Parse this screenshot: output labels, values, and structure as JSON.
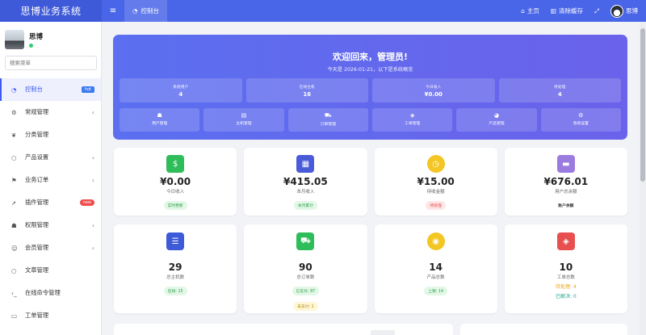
{
  "header": {
    "brand": "思博业务系统",
    "menu_icon": "≡",
    "tab_label": "控制台",
    "home": "主页",
    "clear_cache": "清除缓存",
    "username": "思博"
  },
  "sidebar": {
    "user_name": "思博",
    "search_placeholder": "搜索菜单",
    "items": [
      {
        "label": "控制台",
        "badge": "hot"
      },
      {
        "label": "常规管理"
      },
      {
        "label": "分类管理"
      },
      {
        "label": "产品设置"
      },
      {
        "label": "业务订单"
      },
      {
        "label": "插件管理",
        "badge": "new"
      },
      {
        "label": "权限管理"
      },
      {
        "label": "会员管理"
      },
      {
        "label": "文章管理"
      },
      {
        "label": "在线命令管理"
      },
      {
        "label": "工单管理"
      }
    ]
  },
  "welcome": {
    "title": "欢迎回来，管理员!",
    "subtitle": "今天是 2026-01-21，以下是系统概览",
    "stats": [
      {
        "label": "系统用户",
        "value": "4"
      },
      {
        "label": "在线主机",
        "value": "16"
      },
      {
        "label": "今日收入",
        "value": "¥0.00"
      },
      {
        "label": "待处理",
        "value": "4"
      }
    ],
    "quick": [
      {
        "label": "用户管理"
      },
      {
        "label": "主机管理"
      },
      {
        "label": "订单管理"
      },
      {
        "label": "工单管理"
      },
      {
        "label": "产品管理"
      },
      {
        "label": "系统设置"
      }
    ]
  },
  "cards_row1": [
    {
      "value": "¥0.00",
      "label": "今日收入",
      "tag": "实时更新",
      "color": "#2fbd5a"
    },
    {
      "value": "¥415.05",
      "label": "本月收入",
      "tag": "本月累计",
      "color": "#4a5bd8"
    },
    {
      "value": "¥15.00",
      "label": "待收金额",
      "tag": "待处理",
      "color": "#f3c623"
    },
    {
      "value": "¥676.01",
      "label": "用户总余额",
      "tag": "账户余额",
      "color": "#9b7be0"
    }
  ],
  "cards_row2": [
    {
      "value": "29",
      "label": "总主机数",
      "tag": "在线: 15",
      "color": "#3d5bd8"
    },
    {
      "value": "90",
      "label": "总订单数",
      "tag": "已支付: 87",
      "tag2": "未支付: 1",
      "color": "#2fbd5a"
    },
    {
      "value": "14",
      "label": "产品总数",
      "tag": "上架: 14",
      "color": "#f3c623"
    },
    {
      "value": "10",
      "label": "工单总数",
      "line1": "待处理: 4",
      "line2": "已解决: 0",
      "color": "#e85050"
    }
  ]
}
